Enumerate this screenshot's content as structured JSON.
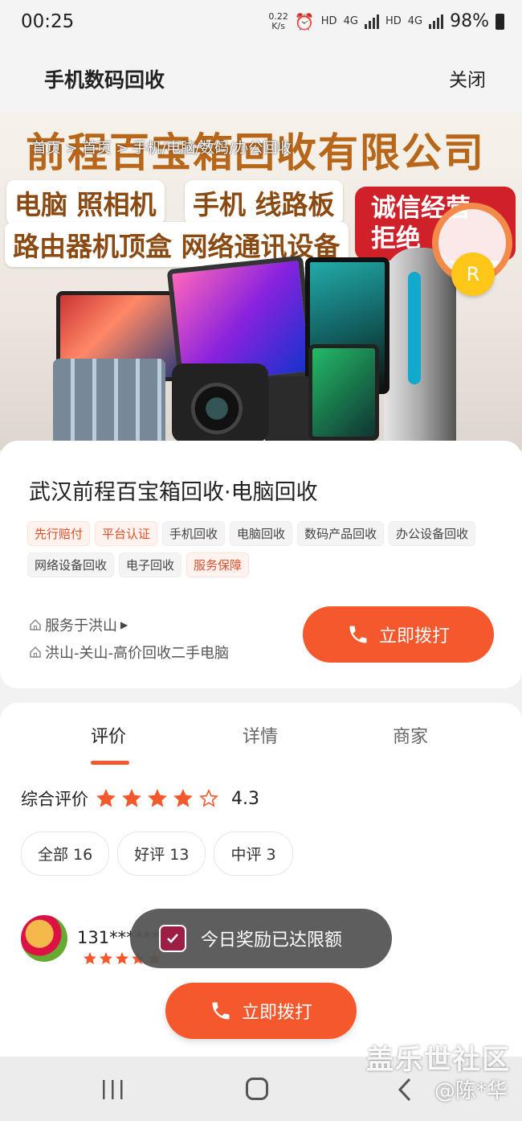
{
  "status_bar": {
    "time": "00:25",
    "speed_value": "0.22",
    "speed_unit": "K/s",
    "hd1": "HD",
    "net1": "4G",
    "hd2": "HD",
    "net2": "4G",
    "battery": "98%"
  },
  "header": {
    "title": "手机数码回收",
    "close_label": "关闭"
  },
  "banner": {
    "company": "前程百宝箱回收有限公司",
    "breadcrumb": "首页 > 首页 > 手机/电脑/数码/办公回收",
    "pill1": "电脑 照相机",
    "pill2": "手机 线路板",
    "pill3": "路由器机顶盒 网络通讯设备",
    "red_badge": "诚信经营\n拒绝",
    "coin_letter": "R"
  },
  "shop": {
    "title": "武汉前程百宝箱回收·电脑回收",
    "tags": [
      {
        "label": "先行赔付",
        "highlight": true
      },
      {
        "label": "平台认证",
        "highlight": true
      },
      {
        "label": "手机回收",
        "highlight": false
      },
      {
        "label": "电脑回收",
        "highlight": false
      },
      {
        "label": "数码产品回收",
        "highlight": false
      },
      {
        "label": "办公设备回收",
        "highlight": false
      },
      {
        "label": "网络设备回收",
        "highlight": false
      },
      {
        "label": "电子回收",
        "highlight": false
      },
      {
        "label": "服务保障",
        "highlight": true
      }
    ],
    "service_area": "服务于洪山",
    "address": "洪山-关山-高价回收二手电脑",
    "call_label": "立即拨打"
  },
  "reviews": {
    "tabs": [
      "评价",
      "详情",
      "商家"
    ],
    "overall_label": "综合评价",
    "rating": 4.3,
    "rating_text": "4.3",
    "filters": [
      "全部 16",
      "好评 13",
      "中评 3"
    ],
    "first_review": {
      "user": "131*******",
      "stars": 5
    }
  },
  "toast": {
    "message": "今日奖励已达限额"
  },
  "floating_call": {
    "label": "立即拨打"
  },
  "watermark": {
    "site": "盖乐世社区",
    "handle": "@陈*华"
  },
  "colors": {
    "accent": "#f5582d",
    "tag_highlight": "#e44f2a",
    "brand_text": "#b8661a"
  }
}
